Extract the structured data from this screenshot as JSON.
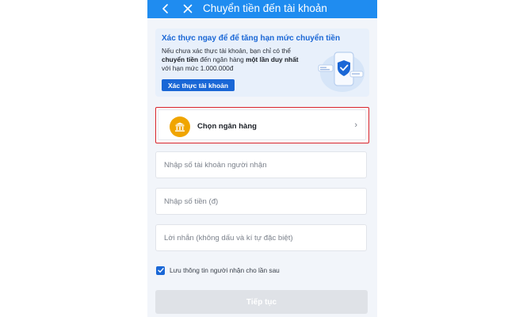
{
  "header": {
    "title": "Chuyển tiền đến tài khoản",
    "back_icon": "chevron-left-icon",
    "close_icon": "close-icon",
    "background_color": "#1f8cf0"
  },
  "promo": {
    "title": "Xác thực ngay để để tăng hạn mức chuyển tiền",
    "body_line1": "Nếu chưa xác thực tài khoản, bạn chỉ có thể",
    "body_bold1": "chuyển tiền",
    "body_mid": " đến ngân hàng ",
    "body_bold2": "một lần duy nhất",
    "body_line3": "với hạn mức 1.000.000đ",
    "button_label": "Xác thực tài khoản",
    "illustration_icon": "shield-check-phone-icon",
    "accent_color": "#1a67d6"
  },
  "bank_select": {
    "label": "Chọn ngân hàng",
    "icon": "bank-icon",
    "chevron": "›",
    "highlight_color": "#d8232a"
  },
  "form": {
    "account_placeholder": "Nhập số tài khoản người nhận",
    "amount_placeholder": "Nhập số tiền (đ)",
    "message_placeholder": "Lời nhắn (không dấu và kí tự đặc biệt)",
    "save_label": "Lưu thông tin người nhận cho lần sau",
    "save_checked": true
  },
  "continue_button": {
    "label": "Tiếp tục",
    "disabled": true
  }
}
